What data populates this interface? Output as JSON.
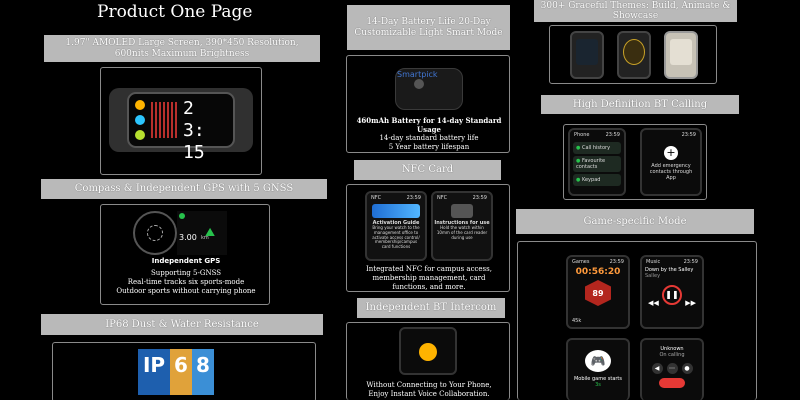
{
  "title": "Product One Page",
  "col1": {
    "screen_banner": "1.97\" AMOLED Large Screen, 390*450 Resolution, 600nits Maximum Brightness",
    "watch_time_top": "23:15",
    "gps_banner": "Compass & Independent GPS with 5 GNSS",
    "gps_card": {
      "label": "Independent GPS",
      "lines": [
        "Supporting 5-GNSS",
        "Real-time tracks six sports-mode",
        "Outdoor sports without carrying phone"
      ],
      "distance": "3.00",
      "unit": "km"
    },
    "ip_banner": "IP68 Dust & Water Resistance",
    "ip_letters": [
      "IP",
      "6",
      "8"
    ]
  },
  "col2": {
    "battery_banner": "14-Day Battery Life 20-Day Customizable Light Smart Mode",
    "battery_card": {
      "watermark": "Smartpick",
      "headline": "460mAh Battery for 14-day Standard Usage",
      "lines": [
        "14-day standard battery life",
        "5 Year battery lifespan"
      ]
    },
    "nfc_banner": "NFC Card",
    "nfc_card": {
      "screen1_header": "NFC",
      "screen1_time": "23:59",
      "screen1_title": "Activation Guide",
      "screen1_text": "Bring your watch to the management office to activate access control/ membership/campus card functions",
      "screen2_header": "NFC",
      "screen2_time": "23:59",
      "screen2_title": "Instructions for use",
      "screen2_text": "Hold the watch within 10mm of the card reader during use",
      "caption": "Integrated NFC for campus access, membership management, card functions, and more."
    },
    "intercom_banner": "Independent BT Intercom",
    "intercom_card": {
      "caption": "Without Connecting to Your Phone, Enjoy Instant Voice Collaboration."
    }
  },
  "col3": {
    "themes_banner": "300+ Graceful Themes: Build, Animate & Showcase",
    "call_banner": "High Definition BT Calling",
    "call_card": {
      "left_header": "Phone",
      "left_time": "23:59",
      "items": [
        "Call history",
        "Favourite contacts",
        "Keypad"
      ],
      "right_time": "23:59",
      "right_text": "Add emergency contacts through App"
    },
    "game_banner": "Game-specific Mode",
    "game_card": {
      "games_header": "Games",
      "games_time": "23:59",
      "timer": "00:56:20",
      "heart": "89",
      "steps": "45k",
      "music_header": "Music",
      "music_time": "23:59",
      "song": "Down by the Salley",
      "artist": "Salley",
      "mobile_label": "Mobile game starts",
      "mobile_sub": "3s",
      "caller": "Unknown",
      "call_status": "On calling"
    }
  }
}
